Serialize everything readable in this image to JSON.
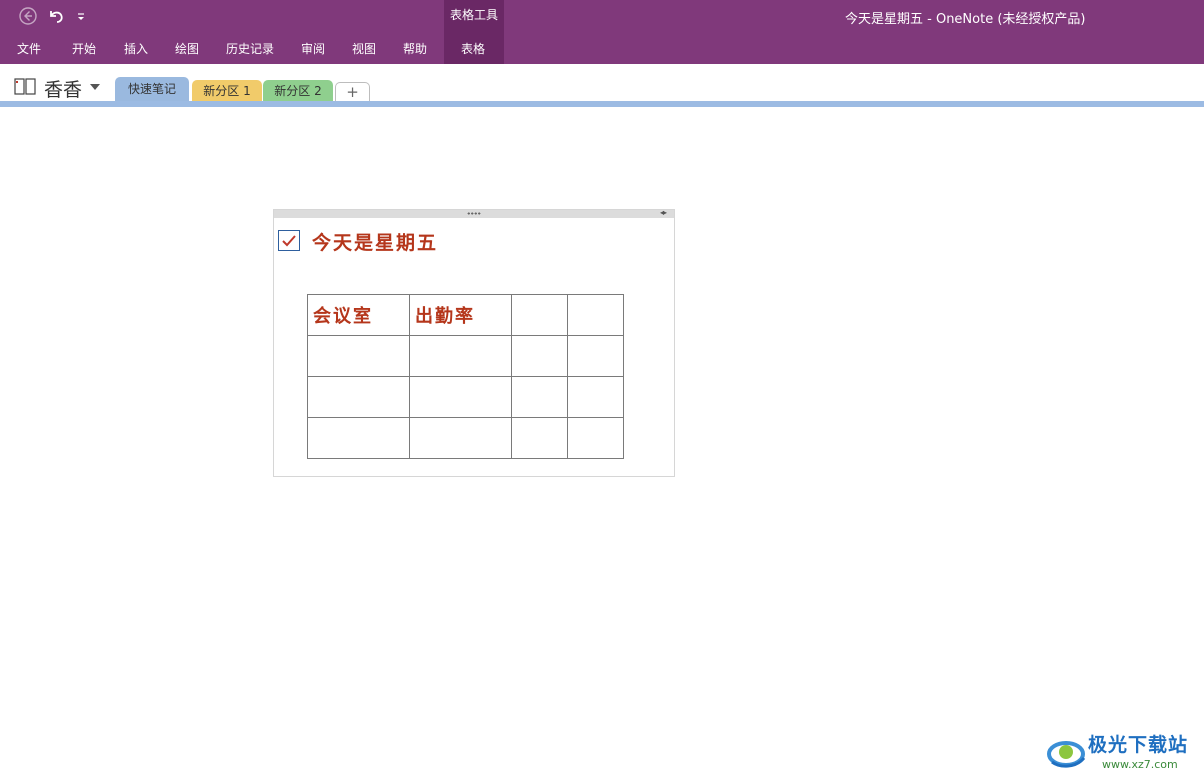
{
  "title_bar": {
    "window_title": "今天是星期五  -  OneNote (未经授权产品)",
    "contextual_group": "表格工具",
    "quick_access": [
      {
        "icon": "back-arrow-icon"
      },
      {
        "icon": "undo-icon"
      },
      {
        "icon": "customize-toolbar-icon"
      }
    ]
  },
  "menu": {
    "file": "文件",
    "home": "开始",
    "insert": "插入",
    "draw": "绘图",
    "history": "历史记录",
    "review": "审阅",
    "view": "视图",
    "help": "帮助",
    "table": "表格"
  },
  "notebook": {
    "name": "香香",
    "sections": [
      {
        "label": "快速笔记",
        "color": "#9ab9df",
        "active": true
      },
      {
        "label": "新分区 1",
        "color": "#f1cb6a",
        "active": false
      },
      {
        "label": "新分区 2",
        "color": "#8fcf8e",
        "active": false
      }
    ],
    "add_section_label": "+"
  },
  "note": {
    "todo_checked": true,
    "title": "今天是星期五",
    "table": [
      [
        "会议室",
        "出勤率",
        "",
        ""
      ],
      [
        "",
        "",
        "",
        ""
      ],
      [
        "",
        "",
        "",
        ""
      ],
      [
        "",
        "",
        "",
        ""
      ]
    ]
  },
  "watermark": {
    "text": "极光下载站",
    "url": "www.xz7.com"
  },
  "colors": {
    "ribbon": "#80397b",
    "contextual_tab": "#6a2865",
    "note_text": "#b5361b"
  }
}
